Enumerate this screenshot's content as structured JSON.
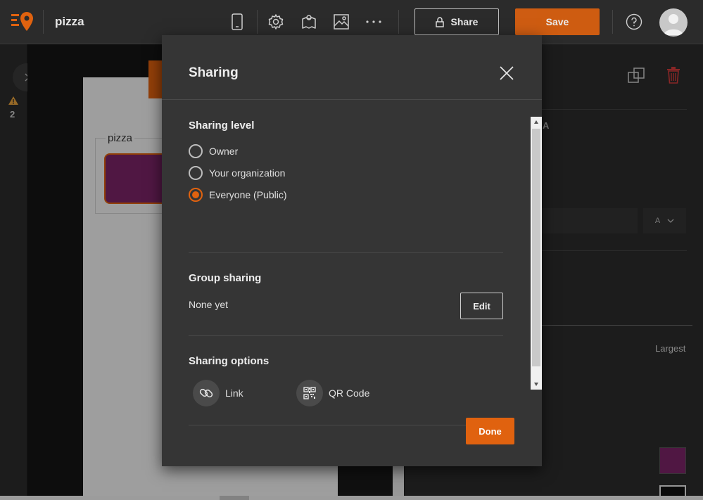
{
  "app": {
    "title": "pizza"
  },
  "toolbar": {
    "icons": [
      "phone-icon",
      "gear-icon",
      "map-icon",
      "image-icon",
      "more-icon"
    ],
    "share_label": "Share",
    "save_label": "Save"
  },
  "left_rail": {
    "warning_count": "2"
  },
  "canvas": {
    "field_label": "pizza"
  },
  "right_panel": {
    "letter": "A",
    "select_value": "A",
    "largest_label": "Largest"
  },
  "dialog": {
    "title": "Sharing",
    "sharing_level": {
      "title": "Sharing level",
      "options": [
        {
          "label": "Owner",
          "selected": false
        },
        {
          "label": "Your organization",
          "selected": false
        },
        {
          "label": "Everyone (Public)",
          "selected": true
        }
      ]
    },
    "group_sharing": {
      "title": "Group sharing",
      "value": "None yet",
      "edit_label": "Edit"
    },
    "sharing_options": {
      "title": "Sharing options",
      "items": [
        {
          "label": "Link",
          "icon": "link-icon"
        },
        {
          "label": "QR Code",
          "icon": "qr-code-icon"
        }
      ]
    },
    "done_label": "Done"
  },
  "colors": {
    "accent": "#e0620f",
    "swatch": "#7b2468"
  }
}
